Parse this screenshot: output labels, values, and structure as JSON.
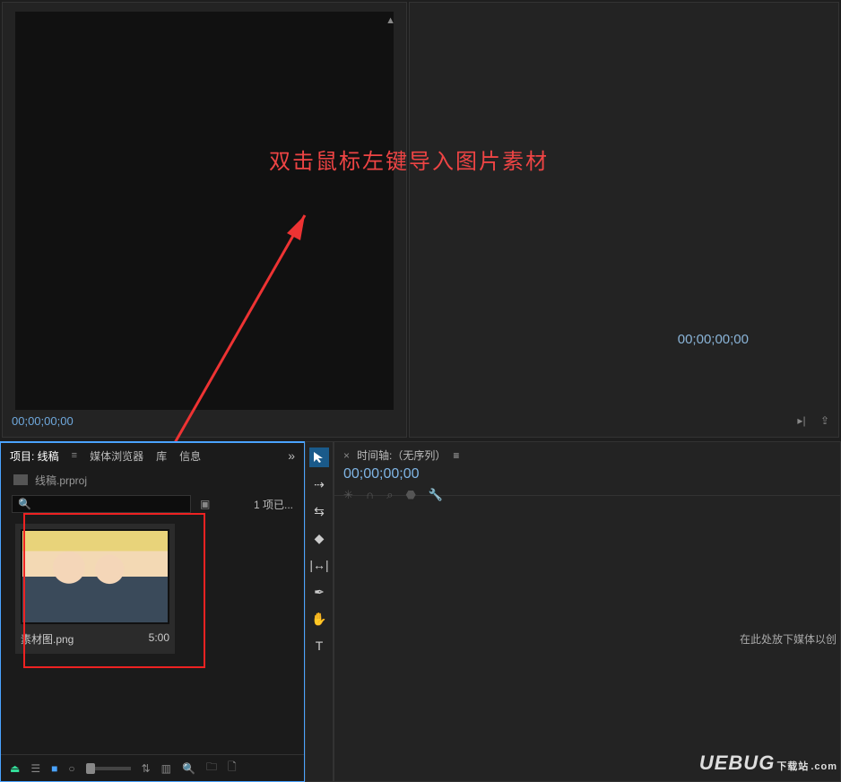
{
  "annotation": {
    "text": "双击鼠标左键导入图片素材"
  },
  "source": {
    "timecode": "00;00;00;00"
  },
  "program": {
    "timecode": "00;00;00;00"
  },
  "project": {
    "tabs": {
      "project": "项目: 线稿",
      "browser": "媒体浏览器",
      "library": "库",
      "info": "信息"
    },
    "file": "线稿.prproj",
    "item_count": "1 项已...",
    "asset": {
      "name": "素材图.png",
      "duration": "5:00"
    }
  },
  "timeline": {
    "title": "时间轴:（无序列）",
    "timecode": "00;00;00;00",
    "hint": "在此处放下媒体以创"
  },
  "watermark": {
    "brand": "UEBUG",
    "sub": "下载站",
    "dom": ".com"
  }
}
